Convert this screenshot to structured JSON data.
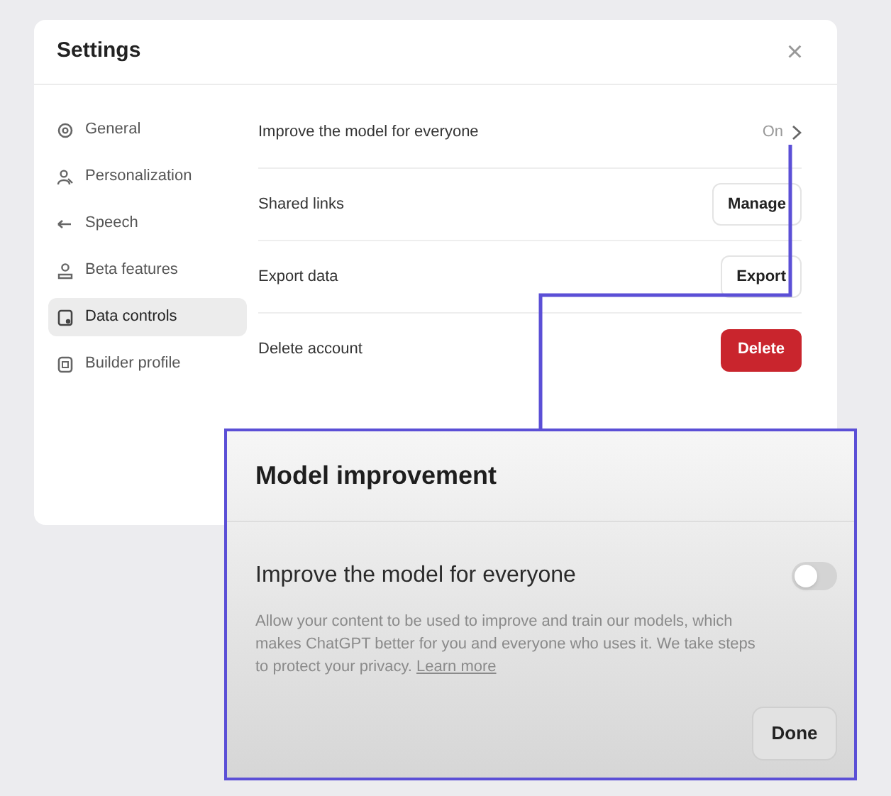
{
  "settings": {
    "title": "Settings",
    "close": "×",
    "sidebar": [
      {
        "label": "General",
        "selected": false
      },
      {
        "label": "Personalization",
        "selected": false
      },
      {
        "label": "Speech",
        "selected": false
      },
      {
        "label": "Beta features",
        "selected": false
      },
      {
        "label": "Data controls",
        "selected": true
      },
      {
        "label": "Builder profile",
        "selected": false
      }
    ],
    "rows": [
      {
        "kind": "status",
        "label": "Improve the model for everyone",
        "value": "On"
      },
      {
        "kind": "button",
        "label": "Shared links",
        "button": "Manage"
      },
      {
        "kind": "button",
        "label": "Export data",
        "button": "Export"
      },
      {
        "kind": "danger",
        "label": "Delete account",
        "button": "Delete"
      }
    ]
  },
  "callout": {
    "title": "Model improvement",
    "setting": "Improve the model for everyone",
    "on": false,
    "description": "Allow your content to be used to improve and train our models, which makes ChatGPT better for you and everyone who uses it. We take steps to protect your privacy.",
    "link": "Learn more",
    "done": "Done"
  }
}
